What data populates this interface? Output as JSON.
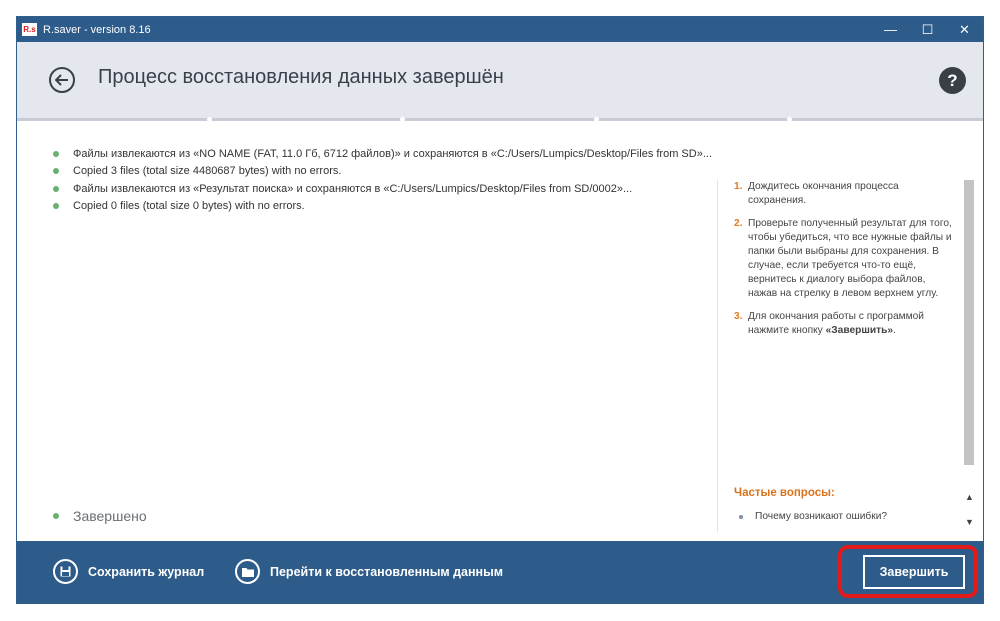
{
  "titlebar": {
    "app_icon_text": "R.s",
    "title": "R.saver - version 8.16",
    "minimize_glyph": "—",
    "maximize_glyph": "☐",
    "close_glyph": "✕"
  },
  "header": {
    "title": "Процесс восстановления данных завершён",
    "help_glyph": "?"
  },
  "log": [
    "Файлы извлекаются из «NO NAME (FAT, 11.0 Гб, 6712 файлов)» и сохраняются в «C:/Users/Lumpics/Desktop/Files from SD»...",
    "Copied 3 files (total size 4480687 bytes) with no errors.",
    "Файлы извлекаются из «Результат поиска» и сохраняются в «C:/Users/Lumpics/Desktop/Files from SD/0002»...",
    "Copied 0 files (total size 0 bytes) with no errors."
  ],
  "status": "Завершено",
  "help_panel": {
    "steps": [
      {
        "num": "1.",
        "text": "Дождитесь окончания процесса сохранения."
      },
      {
        "num": "2.",
        "text": "Проверьте полученный результат для того, чтобы убедиться, что все нужные файлы и папки были выбраны для сохранения. В случае, если требуется что-то ещё, вернитесь к диалогу выбора файлов, нажав на стрелку в левом верхнем углу."
      },
      {
        "num": "3.",
        "text_before": "Для окончания работы с программой нажмите кнопку ",
        "text_bold": "«Завершить»",
        "text_after": "."
      }
    ],
    "faq_title": "Частые вопросы:",
    "faq_items": [
      "Почему возникают ошибки?"
    ]
  },
  "footer": {
    "save_log_label": "Сохранить журнал",
    "open_recovered_label": "Перейти к восстановленным данным",
    "finish_label": "Завершить"
  },
  "colors": {
    "titlebar": "#2d5b8a",
    "header": "#e5e7ef",
    "accent_orange": "#e07b22",
    "highlight_red": "#e21a1a",
    "dot_green": "#69b06e"
  }
}
